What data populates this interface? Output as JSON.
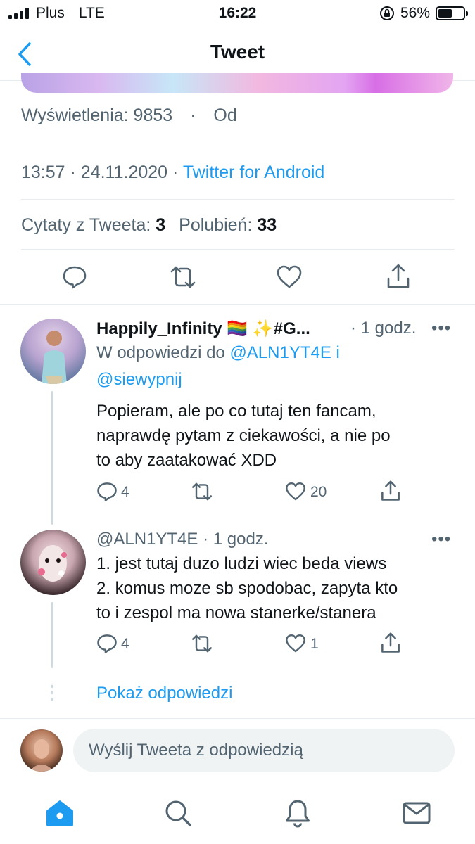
{
  "status_bar": {
    "carrier": "Plus",
    "network": "LTE",
    "time": "16:22",
    "battery": "56%",
    "battery_level": 0.56
  },
  "nav": {
    "title": "Tweet"
  },
  "tweet": {
    "views_label": "Wyświetlenia: 9853",
    "separator": "·",
    "views_from": "Od",
    "time": "13:57",
    "date": "24.11.2020",
    "source": "Twitter for Android",
    "quotes_label": "Cytaty z Tweeta:",
    "quotes_count": "3",
    "likes_label": "Polubień:",
    "likes_count": "33"
  },
  "replies": [
    {
      "name": "Happily_Infinity 🏳️‍🌈 ✨#G...",
      "time": "· 1 godz.",
      "reply_to_prefix": "W odpowiedzi do",
      "reply_to_user1": "@ALN1YT4E",
      "reply_to_and": "i",
      "reply_to_user2": "@siewypnij",
      "lines": [
        "Popieram, ale po co tutaj ten fancam,",
        "naprawdę pytam z ciekawości, a nie po",
        "to aby zaatakować XDD"
      ],
      "reply_count": "4",
      "retweet_count": "",
      "like_count": "20"
    },
    {
      "handle": "@ALN1YT4E",
      "time": "· 1 godz.",
      "lines": [
        "1. jest tutaj duzo ludzi wiec beda views",
        "2. komus moze sb spodobac, zapyta kto",
        "to i zespol ma nowa stanerke/stanera"
      ],
      "reply_count": "4",
      "retweet_count": "",
      "like_count": "1"
    }
  ],
  "show_replies": "Pokaż odpowiedzi",
  "compose": {
    "placeholder": "Wyślij Tweeta z odpowiedzią"
  },
  "colors": {
    "accent": "#1d9bf0",
    "text": "#0f1419",
    "secondary": "#536471",
    "divider": "#e6ecf0"
  },
  "tabbar": [
    "home-icon",
    "search-icon",
    "notifications-icon",
    "messages-icon"
  ]
}
